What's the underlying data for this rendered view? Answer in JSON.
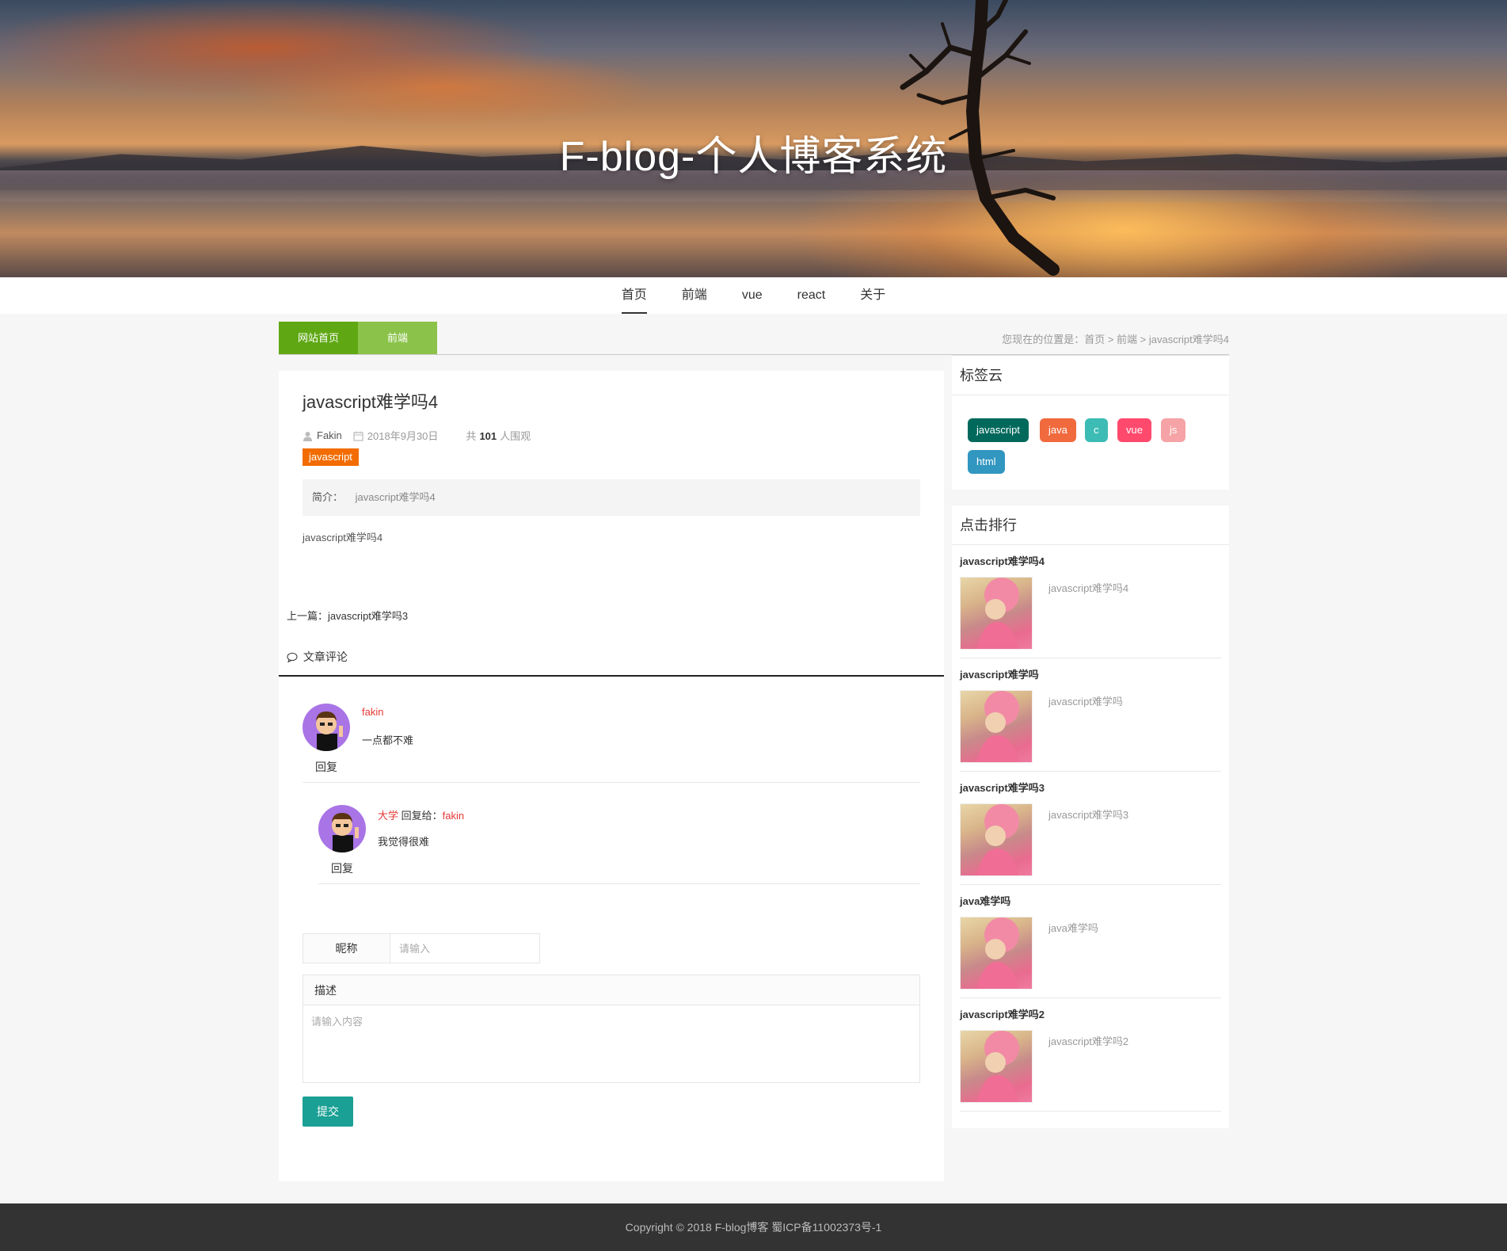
{
  "site": {
    "title": "F-blog-个人博客系统"
  },
  "nav": {
    "items": [
      "首页",
      "前端",
      "vue",
      "react",
      "关于"
    ],
    "active": "首页"
  },
  "breadcrumb": {
    "tab_home": "网站首页",
    "tab_category": "前端",
    "path": "您现在的位置是：首页 > 前端 > javascript难学吗4"
  },
  "article": {
    "title": "javascript难学吗4",
    "author": "Fakin",
    "date": "2018年9月30日",
    "views_prefix": "共",
    "views": "101",
    "views_suffix": "人围观",
    "tag": "javascript",
    "summary_label": "简介：",
    "summary": "javascript难学吗4",
    "body": "javascript难学吗4",
    "prev": "上一篇：javascript难学吗3"
  },
  "comments": {
    "heading": "文章评论",
    "items": [
      {
        "name": "fakin",
        "text": "一点都不难",
        "reply_label": "回复"
      },
      {
        "name": "大学",
        "reply_to_label": "回复给：",
        "reply_to": "fakin",
        "text": "我觉得很难",
        "reply_label": "回复"
      }
    ],
    "form": {
      "nickname_label": "昵称",
      "nickname_placeholder": "请输入",
      "desc_label": "描述",
      "desc_placeholder": "请输入内容",
      "submit": "提交"
    }
  },
  "sidebar": {
    "tag_cloud_title": "标签云",
    "tags": [
      {
        "label": "javascript",
        "color": "#00695c"
      },
      {
        "label": "java",
        "color": "#f06a3e"
      },
      {
        "label": "c",
        "color": "#3cbcb4"
      },
      {
        "label": "vue",
        "color": "#ff4a6e"
      },
      {
        "label": "js",
        "color": "#f5a3a6"
      },
      {
        "label": "html",
        "color": "#3196c0"
      }
    ],
    "rank_title": "点击排行",
    "rank": [
      {
        "title": "javascript难学吗4",
        "desc": "javascript难学吗4"
      },
      {
        "title": "javascript难学吗",
        "desc": "javascript难学吗"
      },
      {
        "title": "javascript难学吗3",
        "desc": "javascript难学吗3"
      },
      {
        "title": "java难学吗",
        "desc": "java难学吗"
      },
      {
        "title": "javascript难学吗2",
        "desc": "javascript难学吗2"
      }
    ]
  },
  "footer": {
    "text": "Copyright © 2018 F-blog博客 蜀ICP备11002373号-1"
  },
  "colors": {
    "breadcrumb_tab_1": "#5fa814",
    "breadcrumb_tab_2": "#8bc34a",
    "article_tag": "#f26c00",
    "submit": "#1aa094",
    "comment_name": "#e53935",
    "footer_bg": "#333333"
  }
}
